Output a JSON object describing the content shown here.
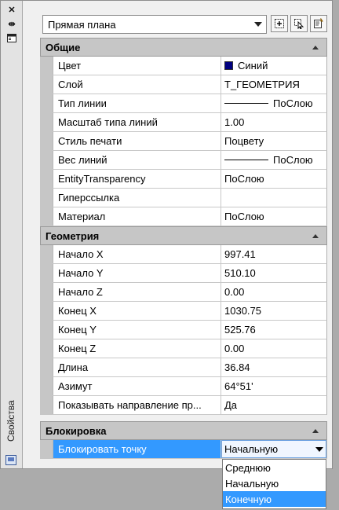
{
  "palette": {
    "title": "Свойства",
    "object_type": "Прямая плана"
  },
  "categories": {
    "general": {
      "title": "Общие",
      "rows": [
        {
          "label": "Цвет",
          "value": "Синий"
        },
        {
          "label": "Слой",
          "value": "Т_ГЕОМЕТРИЯ"
        },
        {
          "label": "Тип линии",
          "value": "ПоСлою"
        },
        {
          "label": "Масштаб типа линий",
          "value": "1.00"
        },
        {
          "label": "Стиль печати",
          "value": "Поцвету"
        },
        {
          "label": "Вес линий",
          "value": "ПоСлою"
        },
        {
          "label": "EntityTransparency",
          "value": "ПоСлою"
        },
        {
          "label": "Гиперссылка",
          "value": ""
        },
        {
          "label": "Материал",
          "value": "ПоСлою"
        }
      ]
    },
    "geometry": {
      "title": "Геометрия",
      "rows": [
        {
          "label": "Начало X",
          "value": "997.41"
        },
        {
          "label": "Начало Y",
          "value": "510.10"
        },
        {
          "label": "Начало Z",
          "value": "0.00"
        },
        {
          "label": "Конец X",
          "value": "1030.75"
        },
        {
          "label": "Конец Y",
          "value": "525.76"
        },
        {
          "label": "Конец Z",
          "value": "0.00"
        },
        {
          "label": "Длина",
          "value": "36.84"
        },
        {
          "label": "Азимут",
          "value": "64°51'"
        },
        {
          "label": "Показывать направление пр...",
          "value": "Да"
        }
      ]
    },
    "lock": {
      "title": "Блокировка",
      "rows": [
        {
          "label": "Блокировать точку",
          "value": "Начальную"
        }
      ]
    }
  },
  "dropdown": {
    "options": [
      "Среднюю",
      "Начальную",
      "Конечную"
    ],
    "highlighted": "Конечную"
  },
  "colors": {
    "selection": "#3399ff",
    "swatch_blue": "#00007f",
    "category_bg": "#c6c6c6"
  },
  "icons": [
    "close-icon",
    "autohide-icon",
    "properties-menu-icon",
    "toggle-pickadd-icon",
    "select-objects-icon",
    "quick-select-icon"
  ]
}
